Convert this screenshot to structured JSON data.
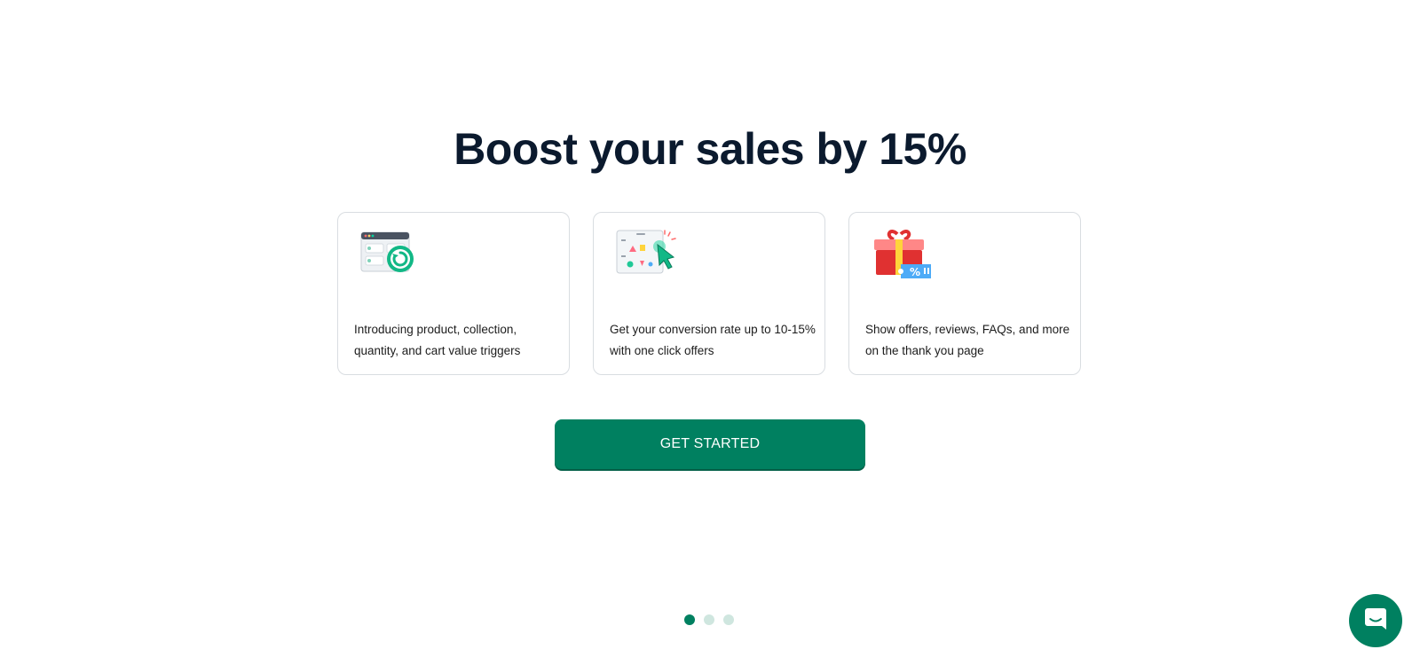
{
  "heading": "Boost your sales by 15%",
  "cards": [
    {
      "icon": "refresh-window-icon",
      "text": "Introducing product, collection, quantity, and cart value triggers"
    },
    {
      "icon": "click-board-icon",
      "text": "Get your conversion rate up to 10-15% with one click offers"
    },
    {
      "icon": "gift-percent-icon",
      "text": "Show offers, reviews, FAQs, and more on the thank you page"
    }
  ],
  "cta_label": "GET STARTED",
  "pagination": {
    "total": 3,
    "active": 1
  },
  "chat_icon": "chat-icon",
  "colors": {
    "accent": "#008060",
    "heading": "#0b1a2e",
    "dot_inactive": "#cfe6df"
  }
}
